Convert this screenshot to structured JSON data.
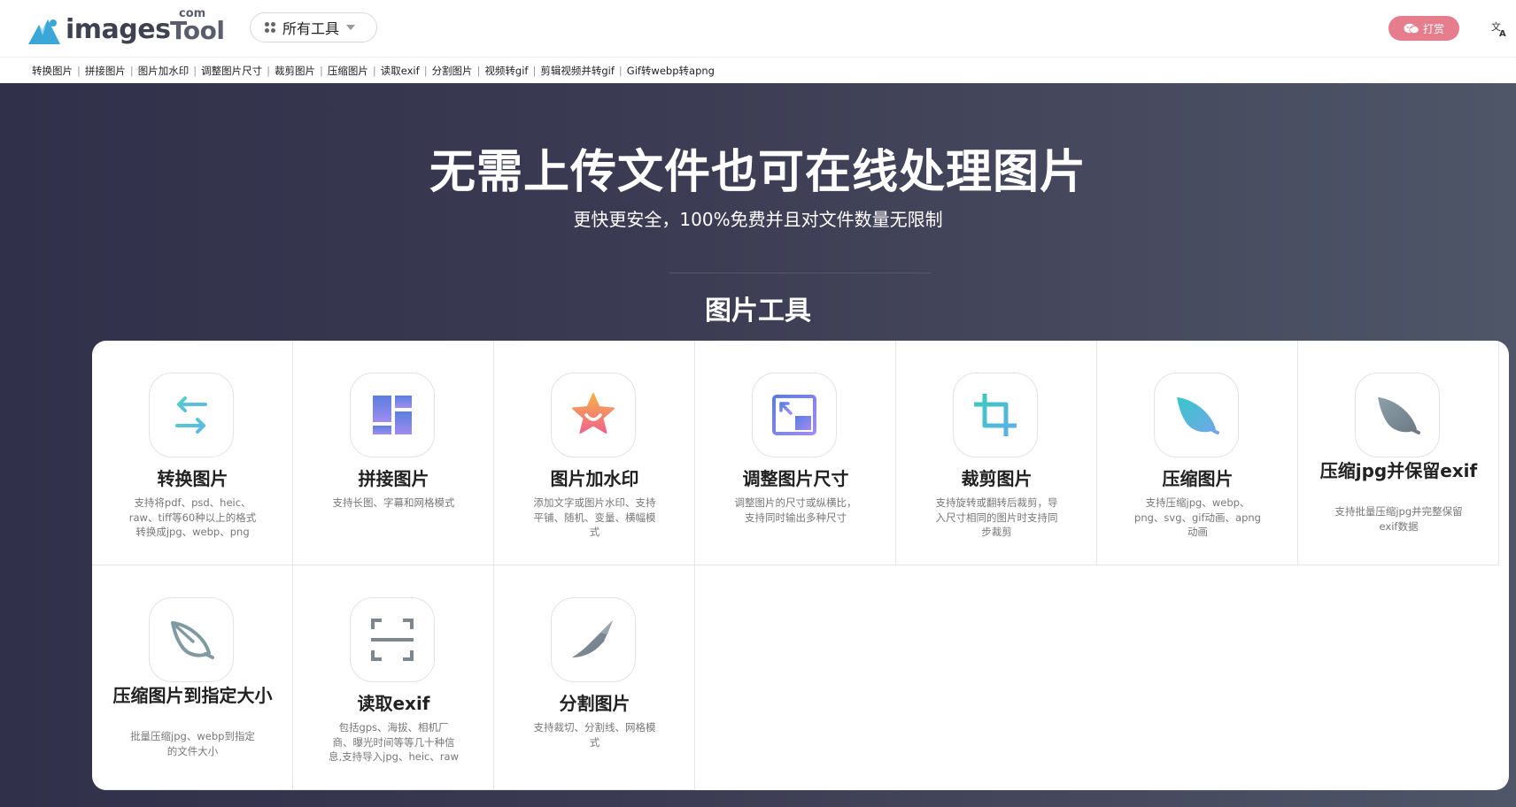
{
  "header": {
    "logo_main": "images",
    "logo_tool": "Tool",
    "logo_com": "com",
    "all_tools_label": "所有工具",
    "donate_label": "打赏",
    "lang_icon": "translate-icon"
  },
  "quicknav": {
    "items": [
      "转换图片",
      "拼接图片",
      "图片加水印",
      "调整图片尺寸",
      "裁剪图片",
      "压缩图片",
      "读取exif",
      "分割图片",
      "视频转gif",
      "剪辑视频并转gif",
      "Gif转webp转apng"
    ],
    "separator": "|"
  },
  "hero": {
    "title": "无需上传文件也可在线处理图片",
    "subtitle": "更快更安全，100%免费并且对文件数量无限制",
    "section_title": "图片工具"
  },
  "tools": [
    {
      "title": "转换图片",
      "desc": "支持将pdf、psd、heic、raw、tiff等60种以上的格式转换成jpg、webp、png",
      "icon": "convert-arrows-icon"
    },
    {
      "title": "拼接图片",
      "desc": "支持长图、字幕和网格模式",
      "icon": "layout-grid-icon"
    },
    {
      "title": "图片加水印",
      "desc": "添加文字或图片水印、支持平铺、随机、变量、横幅模式",
      "icon": "star-smile-icon"
    },
    {
      "title": "调整图片尺寸",
      "desc": "调整图片的尺寸或纵横比，支持同时输出多种尺寸",
      "icon": "resize-icon"
    },
    {
      "title": "裁剪图片",
      "desc": "支持旋转或翻转后裁剪，导入尺寸相同的图片时支持同步裁剪",
      "icon": "crop-icon"
    },
    {
      "title": "压缩图片",
      "desc": "支持压缩jpg、webp、png、svg、gif动画、apng动画",
      "icon": "feather-icon"
    },
    {
      "title": "压缩jpg并保留exif",
      "desc": "支持批量压缩jpg并完整保留exif数据",
      "icon": "feather-gray-icon"
    },
    {
      "title": "压缩图片到指定大小",
      "desc": "批量压缩jpg、webp到指定的文件大小",
      "icon": "feather-outline-icon"
    },
    {
      "title": "读取exif",
      "desc": "包括gps、海拔、相机厂商、曝光时间等等几十种信息,支持导入jpg、heic、raw",
      "icon": "scan-icon"
    },
    {
      "title": "分割图片",
      "desc": "支持裁切、分割线、网格模式",
      "icon": "knife-icon"
    }
  ],
  "colors": {
    "hero_bg_left": "#30304a",
    "hero_bg_right": "#4e5668",
    "donate_bg": "#e57d8c",
    "logo_blue": "#3aa7d8"
  }
}
